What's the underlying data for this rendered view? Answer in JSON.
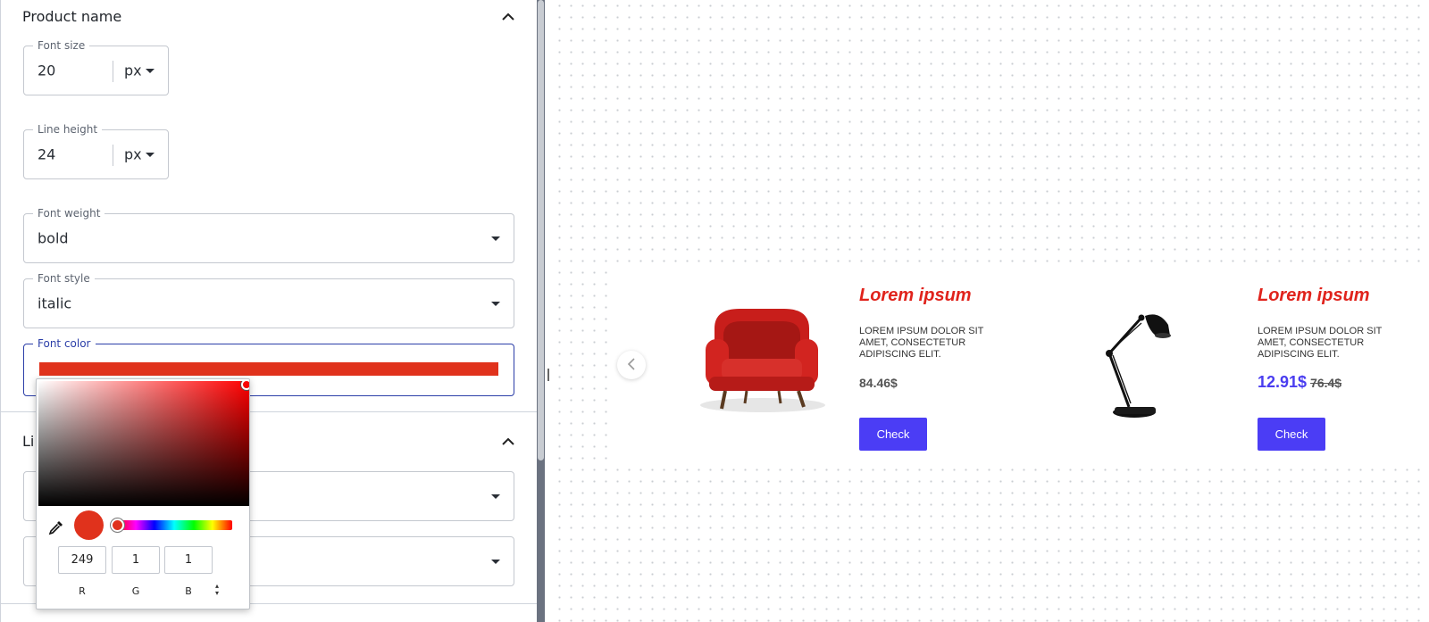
{
  "panel": {
    "section_product_name": {
      "title": "Product name"
    },
    "font_size": {
      "label": "Font size",
      "value": "20",
      "unit": "px"
    },
    "line_height": {
      "label": "Line height",
      "value": "24",
      "unit": "px"
    },
    "font_weight": {
      "label": "Font weight",
      "value": "bold"
    },
    "font_style": {
      "label": "Font style",
      "value": "italic"
    },
    "font_color": {
      "label": "Font color",
      "color": "#f90101"
    },
    "section_second": {
      "title": "Li"
    }
  },
  "color_picker": {
    "r": "249",
    "g": "1",
    "b": "1",
    "labels": {
      "r": "R",
      "g": "G",
      "b": "B"
    },
    "color": "#f90101"
  },
  "canvas": {
    "products": [
      {
        "title": "Lorem ipsum",
        "description": "LOREM IPSUM DOLOR SIT AMET, CONSECTETUR ADIPISCING ELIT.",
        "price": "84.46$",
        "button": "Check"
      },
      {
        "title": "Lorem ipsum",
        "description": "LOREM IPSUM DOLOR SIT AMET, CONSECTETUR ADIPISCING ELIT.",
        "price": "12.91$",
        "old_price": "76.4$",
        "button": "Check"
      }
    ]
  },
  "colors": {
    "accent": "#4b3df5",
    "title_red": "#e0231c",
    "focus_blue": "#2b3ea8"
  }
}
